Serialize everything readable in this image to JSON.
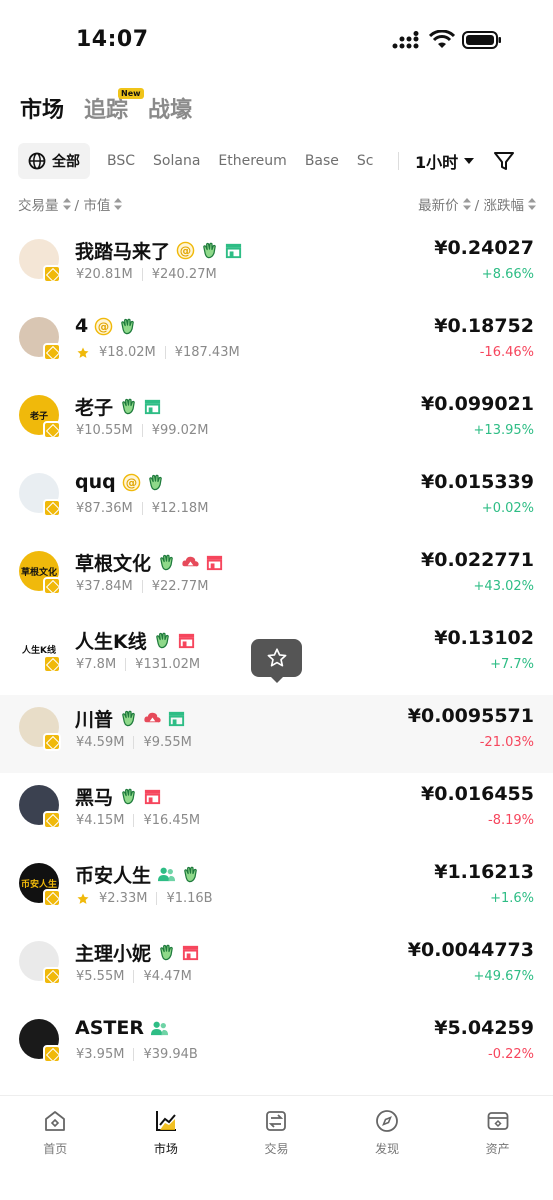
{
  "status_bar": {
    "time": "14:07"
  },
  "top_tabs": [
    {
      "label": "市场",
      "active": true
    },
    {
      "label": "追踪",
      "active": false,
      "badge": "New"
    },
    {
      "label": "战壕",
      "active": false
    }
  ],
  "chain_filter": {
    "all_label": "全部",
    "chains": [
      "BSC",
      "Solana",
      "Ethereum",
      "Base",
      "Sc"
    ],
    "time_range": "1小时"
  },
  "sort_header": {
    "left_a": "交易量",
    "left_b": "/ 市值",
    "right_a": "最新价",
    "right_b": "/ 涨跌幅"
  },
  "tokens": [
    {
      "name": "我踏马来了",
      "avatar_text": "",
      "avatar_color": "#f4e6d6",
      "volume": "¥20.81M",
      "mcap": "¥240.27M",
      "price": "¥0.24027",
      "change": "+8.66%",
      "direction": "up",
      "starred": false,
      "tags": [
        "at",
        "hand",
        "shop-green"
      ]
    },
    {
      "name": "4",
      "avatar_text": "",
      "avatar_color": "#d9c6b3",
      "volume": "¥18.02M",
      "mcap": "¥187.43M",
      "price": "¥0.18752",
      "change": "-16.46%",
      "direction": "down",
      "starred": true,
      "tags": [
        "at",
        "hand"
      ]
    },
    {
      "name": "老子",
      "avatar_text": "老子",
      "avatar_color": "#f0b90b",
      "volume": "¥10.55M",
      "mcap": "¥99.02M",
      "price": "¥0.099021",
      "change": "+13.95%",
      "direction": "up",
      "starred": false,
      "tags": [
        "hand",
        "shop-green"
      ]
    },
    {
      "name": "quq",
      "avatar_text": "",
      "avatar_color": "#e9eef2",
      "volume": "¥87.36M",
      "mcap": "¥12.18M",
      "price": "¥0.015339",
      "change": "+0.02%",
      "direction": "up",
      "starred": false,
      "tags": [
        "at",
        "hand"
      ]
    },
    {
      "name": "草根文化",
      "avatar_text": "草根文化",
      "avatar_color": "#f0b90b",
      "volume": "¥37.84M",
      "mcap": "¥22.77M",
      "price": "¥0.022771",
      "change": "+43.02%",
      "direction": "up",
      "starred": false,
      "tags": [
        "hand",
        "cloud-red",
        "shop-red"
      ]
    },
    {
      "name": "人生K线",
      "avatar_text": "人生K线",
      "avatar_color": "#ffffff",
      "volume": "¥7.8M",
      "mcap": "¥131.02M",
      "price": "¥0.13102",
      "change": "+7.7%",
      "direction": "up",
      "starred": false,
      "tags": [
        "hand",
        "shop-red"
      ]
    },
    {
      "name": "川普",
      "avatar_text": "",
      "avatar_color": "#e8ddc8",
      "volume": "¥4.59M",
      "mcap": "¥9.55M",
      "price": "¥0.0095571",
      "change": "-21.03%",
      "direction": "down",
      "starred": false,
      "tags": [
        "hand",
        "cloud-red",
        "shop-green"
      ],
      "highlight": true
    },
    {
      "name": "黑马",
      "avatar_text": "",
      "avatar_color": "#3b4150",
      "volume": "¥4.15M",
      "mcap": "¥16.45M",
      "price": "¥0.016455",
      "change": "-8.19%",
      "direction": "down",
      "starred": false,
      "tags": [
        "hand",
        "shop-red"
      ]
    },
    {
      "name": "币安人生",
      "avatar_text": "币安人生",
      "avatar_color": "#111111",
      "volume": "¥2.33M",
      "mcap": "¥1.16B",
      "price": "¥1.16213",
      "change": "+1.6%",
      "direction": "up",
      "starred": true,
      "tags": [
        "people",
        "hand"
      ]
    },
    {
      "name": "主理小妮",
      "avatar_text": "",
      "avatar_color": "#eaeaea",
      "volume": "¥5.55M",
      "mcap": "¥4.47M",
      "price": "¥0.0044773",
      "change": "+49.67%",
      "direction": "up",
      "starred": false,
      "tags": [
        "hand",
        "shop-red"
      ]
    },
    {
      "name": "ASTER",
      "avatar_text": "",
      "avatar_color": "#1a1a1a",
      "volume": "¥3.95M",
      "mcap": "¥39.94B",
      "price": "¥5.04259",
      "change": "-0.22%",
      "direction": "down",
      "starred": false,
      "tags": [
        "people"
      ]
    }
  ],
  "bottom_nav": [
    {
      "label": "首页",
      "icon": "home-icon",
      "active": false
    },
    {
      "label": "市场",
      "icon": "market-chart-icon",
      "active": true
    },
    {
      "label": "交易",
      "icon": "trade-swap-icon",
      "active": false
    },
    {
      "label": "发现",
      "icon": "discover-compass-icon",
      "active": false
    },
    {
      "label": "资产",
      "icon": "wallet-icon",
      "active": false
    }
  ],
  "colors": {
    "up": "#2ebd85",
    "down": "#f6465d",
    "brand": "#f0b90b"
  }
}
